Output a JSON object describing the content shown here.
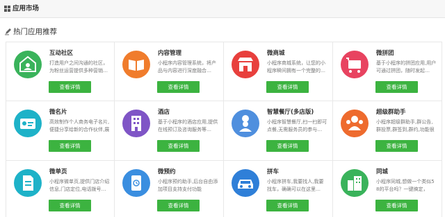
{
  "header": {
    "title": "应用市场",
    "icon": "grid-icon"
  },
  "section": {
    "title": "热门应用推荐",
    "icon": "pen-icon"
  },
  "apps": [
    {
      "name": "互动社区",
      "desc": "打造用户之间沟通的社区，为粉丝运营提供多种营销…",
      "button": "查看详情",
      "color": "#3ab35b",
      "icon": "community-icon"
    },
    {
      "name": "内容管理",
      "desc": "小程序内容管理系统，将产品与内容进行深度融合…",
      "button": "查看详情",
      "color": "#f07c2c",
      "icon": "book-icon"
    },
    {
      "name": "微商城",
      "desc": "小程序商城系统，让您的小程序瞬间拥有一个完整的…",
      "button": "查看详情",
      "color": "#e8403d",
      "icon": "store-icon"
    },
    {
      "name": "微拼团",
      "desc": "基于小程序的拼团应用,用户可通过拼团，随时发起…",
      "button": "查看详情",
      "color": "#e84360",
      "icon": "cart-icon"
    },
    {
      "name": "微名片",
      "desc": "高效制作个人商务电子名片,便捷分享给新的合作伙伴,展示更多…",
      "button": "查看详情",
      "color": "#1eb2c8",
      "icon": "card-icon"
    },
    {
      "name": "酒店",
      "desc": "基于小程序的酒店应用,提供在线预订及咨询服务等…",
      "button": "查看详情",
      "color": "#7f55c6",
      "icon": "hotel-icon"
    },
    {
      "name": "智慧餐厅(多店版)",
      "desc": "小程序智慧餐厅,扫一扫即可点餐,无需服务员的参与…",
      "button": "查看详情",
      "color": "#4f8fde",
      "icon": "chef-icon"
    },
    {
      "name": "超级群助手",
      "desc": "小程序超级群助手,群公告,群投票,群签到,群约,功能很多…",
      "button": "查看详情",
      "color": "#ee6b2e",
      "icon": "group-icon"
    },
    {
      "name": "微单页",
      "desc": "小程序微单页,提供门店介绍信息,门店定位,电话拨号…",
      "button": "查看详情",
      "color": "#1eb2c8",
      "icon": "page-icon"
    },
    {
      "name": "微预约",
      "desc": "小程序预约助手,后台自由添加项目支持支付功能",
      "button": "查看详情",
      "color": "#3a8ee0",
      "icon": "appointment-icon"
    },
    {
      "name": "拼车",
      "desc": "小程序拼车,我要找人,我要找车，确确可以在这里…",
      "button": "查看详情",
      "color": "#2f7fd8",
      "icon": "car-icon"
    },
    {
      "name": "同城",
      "desc": "小程序同城,想做一个类似58的平台吗？一键搞定，给…",
      "button": "查看详情",
      "color": "#3ab35b",
      "icon": "city-icon"
    }
  ]
}
